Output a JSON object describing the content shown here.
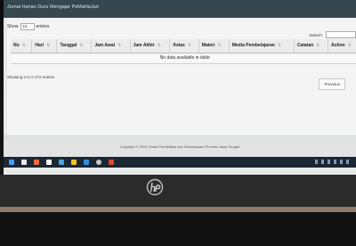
{
  "window": {
    "title": "Jurnal Harian Guru Mengajar PeMaHaJari"
  },
  "controls": {
    "show_label": "Show",
    "show_value": "10",
    "entries_label": "entries",
    "search_label": "Search:"
  },
  "table": {
    "columns": [
      "No",
      "Hari",
      "Tanggal",
      "Jam Awal",
      "Jam Akhir",
      "Kelas",
      "Materi",
      "Media Pembelajaran",
      "Catatan",
      "Action"
    ],
    "empty_message": "No data available in table"
  },
  "table_info": "Showing 0 to 0 of 0 entries",
  "pagination": {
    "previous": "Previous"
  },
  "footer": {
    "text": "Copyright © 2021 Dinas Pendidikan dan Kebudayaan Provinsi Jawa Tengah"
  },
  "colors": {
    "title_strip": "#37474f",
    "taskbar": "#1b2733",
    "taskbar_icons": [
      "#3ea0ff",
      "#e8e8e8",
      "#f06a3a",
      "#ffffff",
      "#4aa3e0",
      "#f4c21f",
      "#2f8de4",
      "#c9c9c9",
      "#e24a2c"
    ]
  },
  "taskbar": {
    "icons": [
      "windows-icon",
      "search-icon",
      "task-view-icon",
      "store-icon",
      "explorer-icon",
      "folder-icon",
      "edge-icon",
      "cortana-icon",
      "browser-icon"
    ]
  },
  "brand": {
    "logo": "hp-logo"
  }
}
